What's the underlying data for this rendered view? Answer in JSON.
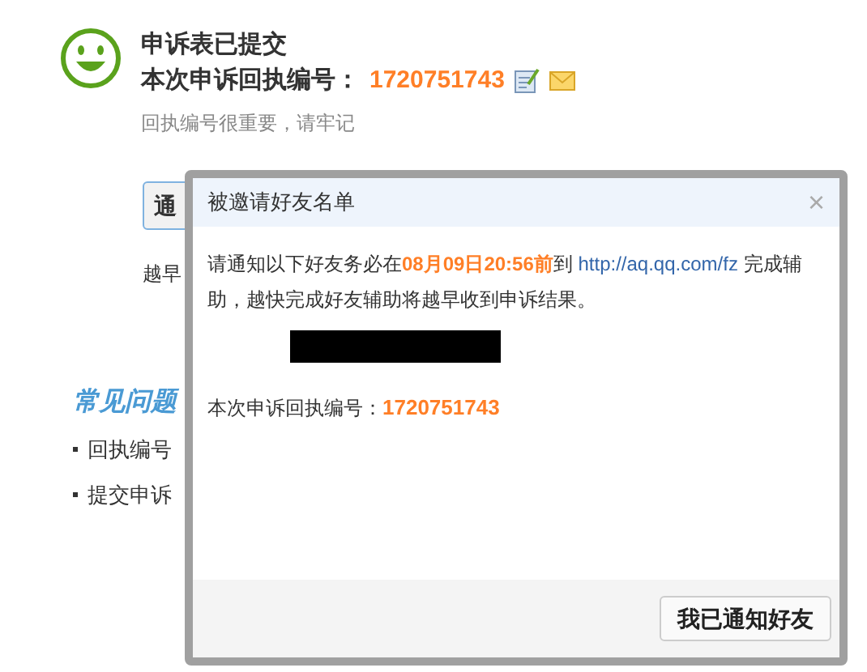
{
  "page": {
    "title": "申诉表已提交",
    "receipt_label": "本次申诉回执编号：",
    "receipt_number": "1720751743",
    "hint": "回执编号很重要，请牢记",
    "notify_button": "通",
    "note": "越早",
    "faq_title": "常见问题",
    "faq_items": [
      "回执编号",
      "提交申诉"
    ]
  },
  "dialog": {
    "title": "被邀请好友名单",
    "close": "×",
    "message": "请通知以下好友务必在**08月09日20:56前**到 ",
    "link": "http://aq.qq.com/fz",
    "message_end": " 完成辅助，越快完成好友辅助将越早收到申诉结果。",
    "receipt_label": "本次申诉回执编号：",
    "receipt_number": "1720751743",
    "confirm_button": "我已通知好友"
  }
}
